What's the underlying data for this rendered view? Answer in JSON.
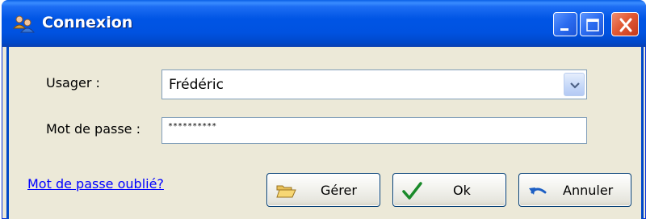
{
  "window": {
    "title": "Connexion"
  },
  "form": {
    "user_label": "Usager :",
    "user_value": "Frédéric",
    "password_label": "Mot de passe :",
    "password_value": "**********"
  },
  "footer": {
    "forgot_link": "Mot de passe oublié?",
    "manage_label": "Gérer",
    "ok_label": "Ok",
    "cancel_label": "Annuler"
  },
  "icons": {
    "title": "users-icon",
    "minimize": "minimize-icon",
    "maximize": "maximize-icon",
    "close": "close-icon",
    "combo": "chevron-down-icon",
    "manage": "folder-open-icon",
    "ok": "checkmark-icon",
    "cancel": "undo-arrow-icon"
  },
  "colors": {
    "titlebar": "#0055e5",
    "close": "#e15a35",
    "link": "#0000ff",
    "check": "#1a8a2a"
  }
}
